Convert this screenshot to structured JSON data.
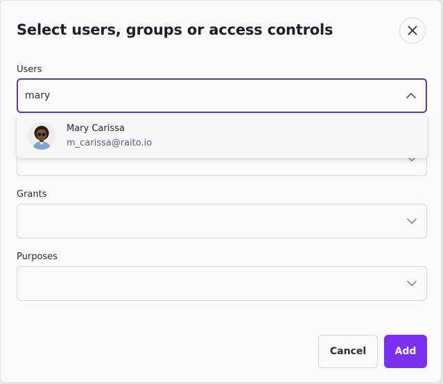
{
  "dialog": {
    "title": "Select users, groups or access controls",
    "close_icon": "close-icon"
  },
  "fields": {
    "users": {
      "label": "Users",
      "value": "mary",
      "state": "expanded"
    },
    "groups": {
      "state": "collapsed"
    },
    "grants": {
      "label": "Grants",
      "value": ""
    },
    "purposes": {
      "label": "Purposes",
      "value": ""
    }
  },
  "dropdown": {
    "options": [
      {
        "name": "Mary Carissa",
        "email": "m_carissa@raito.io",
        "avatar": "user-avatar"
      }
    ]
  },
  "actions": {
    "cancel_label": "Cancel",
    "add_label": "Add"
  },
  "colors": {
    "primary": "#7b2ff0",
    "focus_border": "#5b3b8f",
    "text": "#1f1d2b",
    "muted_text": "#5d5a7a"
  }
}
